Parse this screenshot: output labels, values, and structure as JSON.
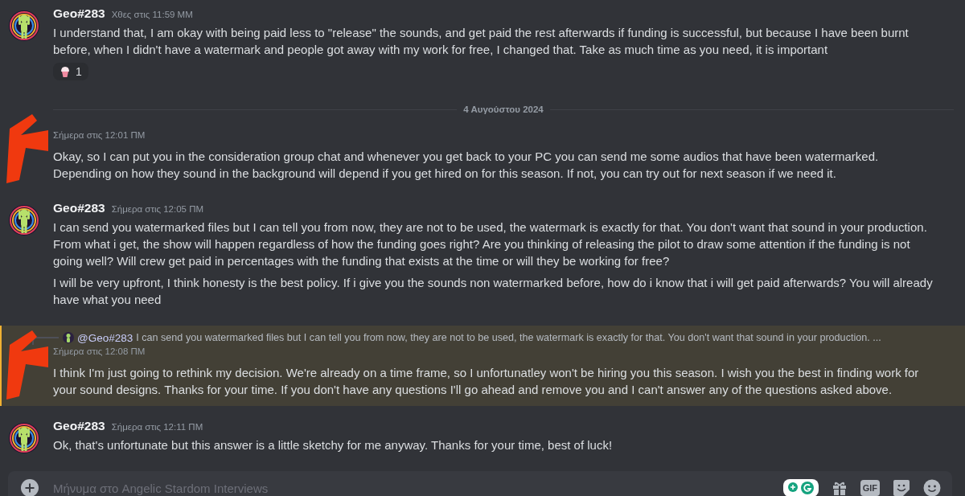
{
  "messages": [
    {
      "kind": "message",
      "author": "Geo#283",
      "time": "Χθες στις 11:59 ΜΜ",
      "redacted": false,
      "highlighted": false,
      "paragraphs": [
        "I understand that, I am okay with being paid less to \"release\" the sounds, and get paid the rest afterwards if funding is successful, but because I have been burnt before, when I didn't have a watermark and people got away with my work for free, I changed that. Take as much time as you need, it is important"
      ],
      "reactions": [
        {
          "count": "1"
        }
      ]
    },
    {
      "kind": "divider",
      "label": "4 Αυγούστου 2024"
    },
    {
      "kind": "message",
      "time": "Σήμερα στις 12:01 ΠΜ",
      "redacted": true,
      "highlighted": false,
      "paragraphs": [
        "Okay, so I can put you in the consideration group chat and whenever you get back to your PC you can send me some audios that have been watermarked. Depending on how they sound in the background will depend if you get hired on for this season. If not, you can try out for next season if we need it."
      ]
    },
    {
      "kind": "message",
      "author": "Geo#283",
      "time": "Σήμερα στις 12:05 ΠΜ",
      "redacted": false,
      "highlighted": false,
      "paragraphs": [
        "I can send you watermarked  files but I can tell you from now, they are not to be used, the watermark is exactly for that. You don't want that sound in your production. From what i get, the show will happen regardless of how the funding goes right? Are you thinking of releasing the pilot to draw some attention if the funding is not going well? Will crew get paid in percentages with the funding that exists at the time or will they be working for free?",
        "I will be very upfront, I think honesty is the best policy. If i give you the sounds non watermarked before, how do i know that i will get paid afterwards? You will already have what you need"
      ]
    },
    {
      "kind": "message",
      "time": "Σήμερα στις 12:08 ΠΜ",
      "redacted": true,
      "highlighted": true,
      "reply": {
        "mention": "@Geo#283",
        "text": "I can send you watermarked  files but I can tell you from now, they are not to be used, the watermark is exactly for that. You don't want that sound in your production. ..."
      },
      "paragraphs": [
        "I think I'm just going to rethink my decision. We're already on a time frame, so I unfortunatley won't be hiring you this season. I wish you the best in finding work for your sound designs. Thanks for your time. If you don't have any questions I'll go ahead and remove you and I can't answer any of the questions asked above."
      ]
    },
    {
      "kind": "message",
      "author": "Geo#283",
      "time": "Σήμερα στις 12:11 ΠΜ",
      "redacted": false,
      "highlighted": false,
      "paragraphs": [
        "Ok, that's unfortunate but this answer is a little sketchy for me anyway. Thanks for your time, best of luck!"
      ]
    }
  ],
  "composer": {
    "placeholder": "Μήνυμα στο Angelic Stardom Interviews",
    "gif_label": "GIF"
  }
}
